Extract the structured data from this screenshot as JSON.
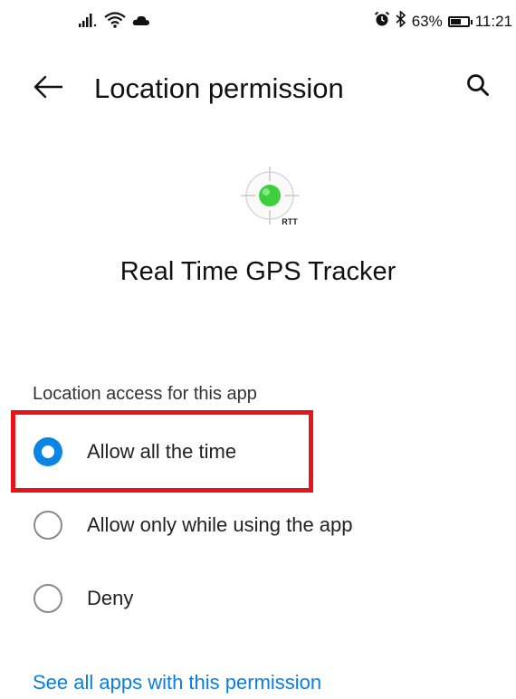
{
  "status_bar": {
    "battery_percent": "63%",
    "battery_level": 0.63,
    "time": "11:21",
    "icons_left": [
      "signal-icon",
      "wifi-icon",
      "cloud-icon"
    ],
    "icons_right": [
      "alarm-icon",
      "bluetooth-icon",
      "battery-icon"
    ]
  },
  "header": {
    "title": "Location permission",
    "back_icon": "back-arrow-icon",
    "search_icon": "search-icon"
  },
  "app": {
    "name": "Real Time GPS Tracker",
    "icon_text": "RTT",
    "icon_color": "#3ecf3e"
  },
  "permission": {
    "section_label": "Location access for this app",
    "options": [
      {
        "label": "Allow all the time",
        "selected": true
      },
      {
        "label": "Allow only while using the app",
        "selected": false
      },
      {
        "label": "Deny",
        "selected": false
      }
    ]
  },
  "footer": {
    "link": "See all apps with this permission"
  },
  "colors": {
    "accent": "#0b84e3",
    "link": "#0b7de3",
    "highlight_box": "#e8141b"
  }
}
